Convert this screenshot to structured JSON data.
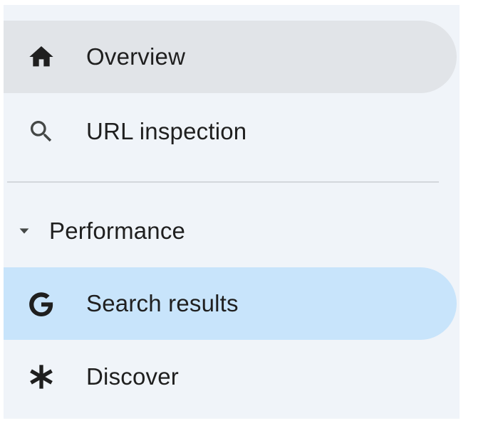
{
  "nav": {
    "overview": {
      "label": "Overview",
      "icon": "home-icon",
      "selected": true
    },
    "url_inspection": {
      "label": "URL inspection",
      "icon": "search-icon"
    },
    "performance_section": {
      "label": "Performance",
      "icon": "caret-down-icon",
      "expanded": true
    },
    "search_results": {
      "label": "Search results",
      "icon": "google-g-icon",
      "selected": true
    },
    "discover": {
      "label": "Discover",
      "icon": "asterisk-icon"
    }
  },
  "colors": {
    "sidebar_bg": "#f0f4f9",
    "overview_highlight": "#e1e4e8",
    "search_results_highlight": "#c8e4fb",
    "text": "#1f1f1f",
    "divider": "#d3d7dc"
  }
}
